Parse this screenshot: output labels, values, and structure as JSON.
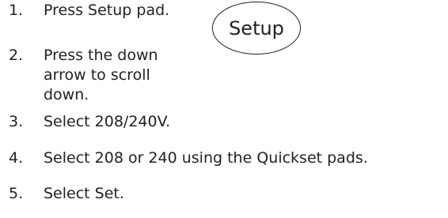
{
  "steps": [
    {
      "number": "1.",
      "text": "Press Setup pad."
    },
    {
      "number": "2.",
      "text": "Press the down arrow to scroll down."
    },
    {
      "number": "3.",
      "text": "Select 208/240V."
    },
    {
      "number": "4.",
      "text": "Select 208 or 240 using the Quickset pads."
    },
    {
      "number": "5.",
      "text": "Select Set."
    }
  ],
  "setup_pad": {
    "label": "Setup"
  }
}
